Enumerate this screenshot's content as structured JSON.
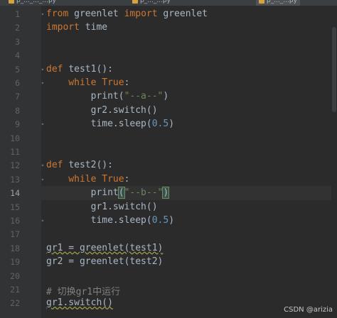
{
  "tabs": [
    {
      "label": "p_..._..._...py",
      "active": false
    },
    {
      "label": "p_..._...py",
      "active": false
    },
    {
      "label": "p_..._...py",
      "active": true
    }
  ],
  "editor": {
    "current_line": 14,
    "lines": [
      {
        "n": "1",
        "tokens": [
          {
            "t": "from ",
            "c": "kw"
          },
          {
            "t": "greenlet ",
            "c": ""
          },
          {
            "t": "import ",
            "c": "kw"
          },
          {
            "t": "greenlet",
            "c": ""
          }
        ]
      },
      {
        "n": "2",
        "tokens": [
          {
            "t": "import ",
            "c": "kw"
          },
          {
            "t": "time",
            "c": ""
          }
        ]
      },
      {
        "n": "3",
        "tokens": []
      },
      {
        "n": "4",
        "tokens": []
      },
      {
        "n": "5",
        "tokens": [
          {
            "t": "def ",
            "c": "kw"
          },
          {
            "t": "test1",
            "c": ""
          },
          {
            "t": "():",
            "c": ""
          }
        ]
      },
      {
        "n": "6",
        "tokens": [
          {
            "t": "    while ",
            "c": "kw"
          },
          {
            "t": "True",
            "c": "kw"
          },
          {
            "t": ":",
            "c": ""
          }
        ]
      },
      {
        "n": "7",
        "tokens": [
          {
            "t": "        print(",
            "c": ""
          },
          {
            "t": "\"--a--\"",
            "c": "str"
          },
          {
            "t": ")",
            "c": ""
          }
        ]
      },
      {
        "n": "8",
        "tokens": [
          {
            "t": "        gr2.switch()",
            "c": ""
          }
        ]
      },
      {
        "n": "9",
        "tokens": [
          {
            "t": "        time.sleep(",
            "c": ""
          },
          {
            "t": "0.5",
            "c": "num"
          },
          {
            "t": ")",
            "c": ""
          }
        ]
      },
      {
        "n": "10",
        "tokens": []
      },
      {
        "n": "11",
        "tokens": []
      },
      {
        "n": "12",
        "tokens": [
          {
            "t": "def ",
            "c": "kw"
          },
          {
            "t": "test2",
            "c": ""
          },
          {
            "t": "():",
            "c": ""
          }
        ]
      },
      {
        "n": "13",
        "tokens": [
          {
            "t": "    while ",
            "c": "kw"
          },
          {
            "t": "True",
            "c": "kw"
          },
          {
            "t": ":",
            "c": ""
          }
        ]
      },
      {
        "n": "14",
        "tokens": [
          {
            "t": "        print",
            "c": ""
          },
          {
            "t": "(",
            "c": "match"
          },
          {
            "t": "\"--b--\"",
            "c": "str"
          },
          {
            "t": ")",
            "c": "match"
          }
        ]
      },
      {
        "n": "15",
        "tokens": [
          {
            "t": "        gr1.switch()",
            "c": ""
          }
        ]
      },
      {
        "n": "16",
        "tokens": [
          {
            "t": "        time.sleep(",
            "c": ""
          },
          {
            "t": "0.5",
            "c": "num"
          },
          {
            "t": ")",
            "c": ""
          }
        ]
      },
      {
        "n": "17",
        "tokens": []
      },
      {
        "n": "18",
        "tokens": [
          {
            "t": "gr1 = greenlet(test1)",
            "c": "squig"
          }
        ]
      },
      {
        "n": "19",
        "tokens": [
          {
            "t": "gr2 = greenlet(test2)",
            "c": ""
          }
        ]
      },
      {
        "n": "20",
        "tokens": []
      },
      {
        "n": "21",
        "tokens": [
          {
            "t": "# 切换gr1中运行",
            "c": "cm"
          }
        ]
      },
      {
        "n": "22",
        "tokens": [
          {
            "t": "gr1.switch()",
            "c": "squig"
          }
        ]
      }
    ]
  },
  "watermark": "CSDN @arizia"
}
